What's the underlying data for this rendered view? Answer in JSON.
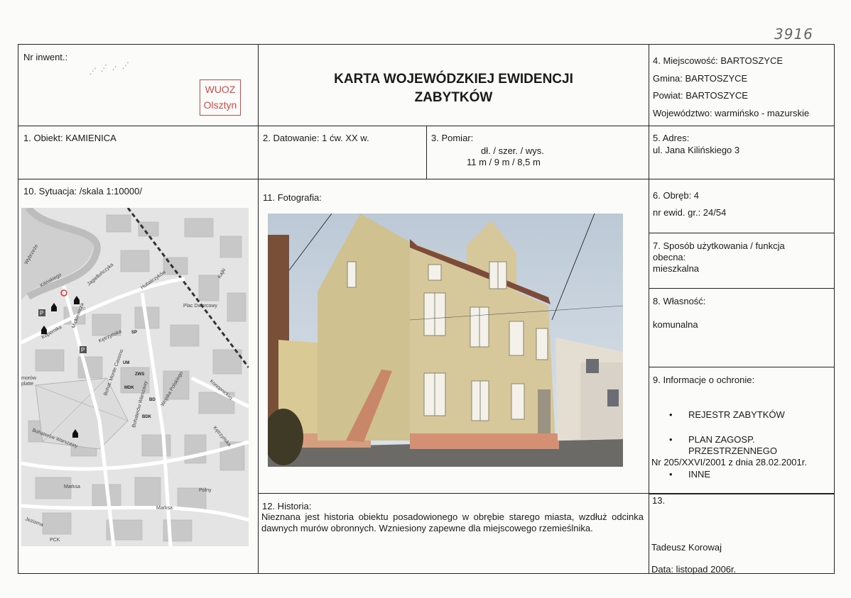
{
  "scan_number": "3916",
  "inventory": {
    "label": "Nr inwent.:"
  },
  "stamp": {
    "line1": "WUOZ",
    "line2": "Olsztyn"
  },
  "card_title": {
    "line1": "KARTA WOJEWÓDZKIEJ EWIDENCJI",
    "line2": "ZABYTKÓW"
  },
  "location": {
    "miejscowosc": "4. Miejscowość: BARTOSZYCE",
    "gmina": "Gmina: BARTOSZYCE",
    "powiat": "Powiat: BARTOSZYCE",
    "wojewodztwo": "Województwo: warmińsko - mazurskie"
  },
  "object": "1. Obiekt: KAMIENICA",
  "dating": "2. Datowanie: 1 ćw. XX w.",
  "measure": {
    "label": "3. Pomiar:",
    "dims_label": "dł. / szer. / wys.",
    "dims_values": "11 m / 9 m / 8,5 m"
  },
  "address": {
    "label": "5. Adres:",
    "value": "ul. Jana Kilińskiego 3"
  },
  "situation": "10. Sytuacja: /skala 1:10000/",
  "photo_label": "11. Fotografia:",
  "precinct": {
    "label": "6. Obręb: 4",
    "parcel": "nr ewid. gr.: 24/54"
  },
  "usage": {
    "label1": "7. Sposób użytkowania / funkcja",
    "label2": "obecna:",
    "value": "mieszkalna"
  },
  "ownership": {
    "label": "8. Własność:",
    "value": "komunalna"
  },
  "protection": {
    "label": "9. Informacje o ochronie:",
    "item1": "REJESTR ZABYTKÓW",
    "item2a": "PLAN ZAGOSP.",
    "item2b": "PRZESTRZENNEGO",
    "item2c": "Nr 205/XXVI/2001 z dnia 28.02.2001r.",
    "item3": "INNE"
  },
  "history": {
    "label": "12. Historia:",
    "text": "Nieznana jest historia obiektu posadowionego w obrębie starego miasta, wzdłuż odcinka dawnych murów obronnych. Wzniesiony zapewne dla miejscowego rzemieślnika."
  },
  "author": {
    "label": "13.",
    "name": "Tadeusz Korowaj",
    "date": "Data: listopad 2006r."
  },
  "map_labels": {
    "wybrzeze": "Wybrzeże",
    "kilinskiego": "Kilińskiego",
    "jagiellonczyka": "Jagiellończyka",
    "hubalczykow": "Hubalczyków",
    "plac_dworcowy": "Plac Dworcowy",
    "kajki": "Kajki",
    "kopernika": "Kopernika",
    "mickiewicza": "Mickiewicza",
    "ketrzynska": "Kętrzyńska",
    "monte_cassino": "Bohat. Monte Cassino",
    "bohaterow_warszawy": "Bohaterów Warszawy",
    "wojska_polskiego": "Wojska Polskiego",
    "bohaterow_warszawy2": "Bohaterów Warszawy",
    "marksa": "Marksa",
    "marksa2": "Marksa",
    "jeziorna": "Jeziorna",
    "pck": "PCK",
    "polny": "Polny",
    "konopnickiej": "Konopnickiej",
    "ketrzynska2": "Kętrzyńska",
    "mdk": "MDK",
    "bdk": "BDK",
    "um": "UM",
    "sp": "SP",
    "bd": "BD",
    "zws": "ZWS",
    "p": "P",
    "morow": "morów",
    "platte": "platte"
  }
}
